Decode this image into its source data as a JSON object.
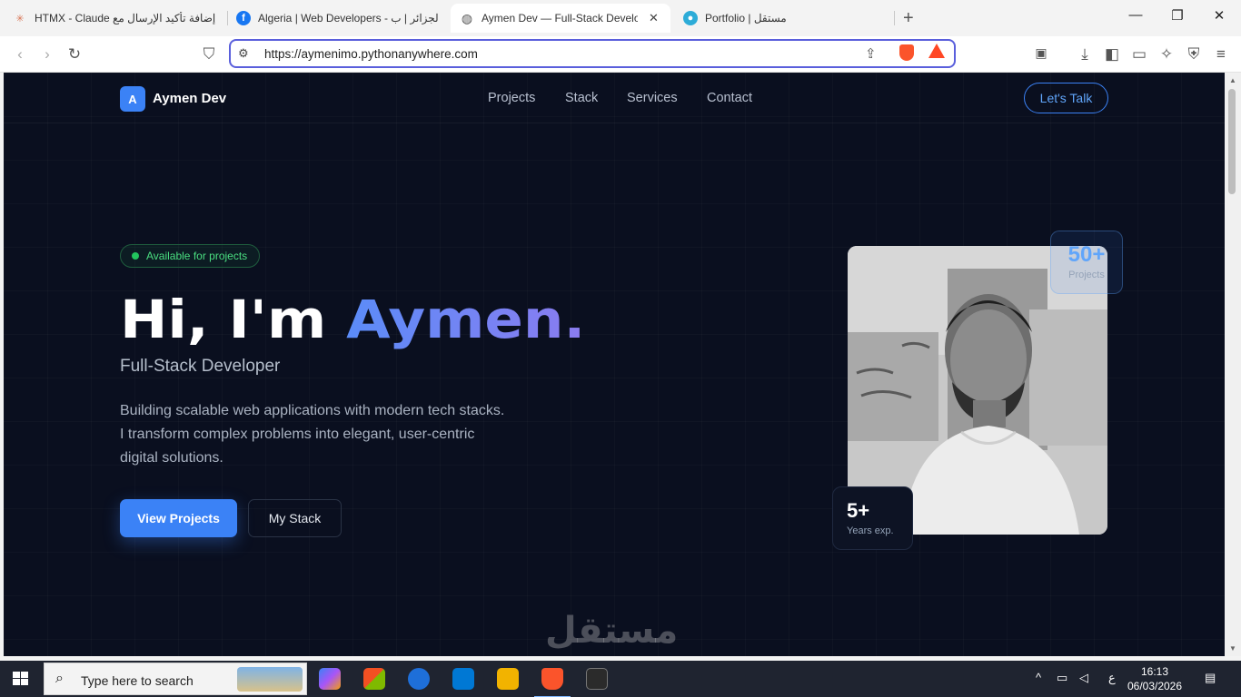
{
  "browser": {
    "tabs": [
      {
        "title": "HTMX - Claude إضافة تأكيد الإرسال مع",
        "icon": "claude-icon",
        "active": false
      },
      {
        "title": "Algeria | Web Developers - الجزائر | ب",
        "icon": "facebook-icon",
        "active": false
      },
      {
        "title": "Aymen Dev — Full-Stack Develo",
        "icon": "globe-icon",
        "active": true
      },
      {
        "title": "Portfolio | مستقل",
        "icon": "mostaql-icon",
        "active": false
      }
    ],
    "url": "https://aymenimo.pythonanywhere.com",
    "accent": "#5a5fdc"
  },
  "site": {
    "logo_letter": "A",
    "logo_text": "Aymen Dev",
    "nav": [
      "Projects",
      "Stack",
      "Services",
      "Contact"
    ],
    "cta": "Let's Talk",
    "badge": "Available for projects",
    "title_prefix": "Hi, I'm ",
    "title_name": "Aymen.",
    "subtitle": "Full-Stack Developer",
    "description_lines": [
      "Building scalable web applications with modern tech stacks.",
      "I transform complex problems into elegant, user-centric",
      "digital solutions."
    ],
    "primary_button": "View Projects",
    "secondary_button": "My Stack",
    "stat_projects": {
      "value": "50+",
      "label": "Projects"
    },
    "stat_years": {
      "value": "5+",
      "label": "Years exp."
    },
    "colors": {
      "background": "#0a0f1f",
      "accent": "#3b82f6",
      "available": "#22c55e"
    }
  },
  "watermark": "مستقل",
  "taskbar": {
    "search_placeholder": "Type here to search",
    "time": "16:13",
    "date": "06/03/2026",
    "lang": "ع"
  }
}
